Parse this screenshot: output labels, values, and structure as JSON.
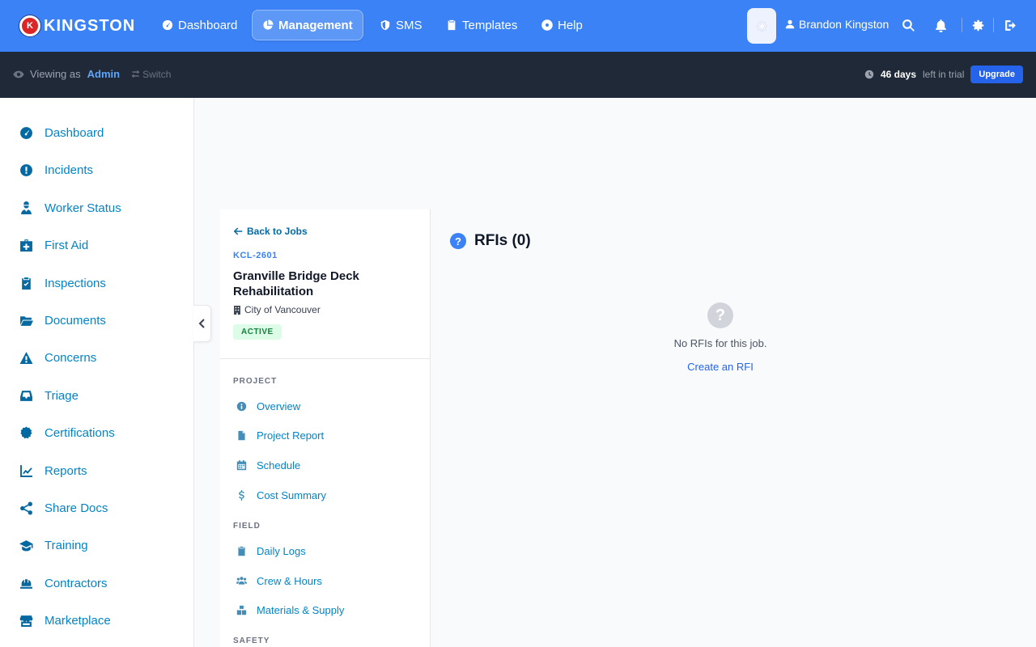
{
  "brand": {
    "name": "KINGSTON",
    "badge": "K"
  },
  "topnav": {
    "items": [
      {
        "label": "Dashboard",
        "icon": "gauge-icon"
      },
      {
        "label": "Management",
        "icon": "pie-chart-icon",
        "active": true
      },
      {
        "label": "SMS",
        "icon": "shield-icon"
      },
      {
        "label": "Templates",
        "icon": "clipboard-icon"
      },
      {
        "label": "Help",
        "icon": "lifebuoy-icon"
      }
    ],
    "user_name": "Brandon Kingston"
  },
  "subbar": {
    "viewing_prefix": "Viewing as",
    "role": "Admin",
    "switch_label": "Switch",
    "trial_days": "46 days",
    "trial_suffix": "left in trial",
    "upgrade_label": "Upgrade"
  },
  "sidebar": {
    "items": [
      {
        "label": "Dashboard",
        "icon": "gauge-icon"
      },
      {
        "label": "Incidents",
        "icon": "alert-circle-icon"
      },
      {
        "label": "Worker Status",
        "icon": "worker-icon"
      },
      {
        "label": "First Aid",
        "icon": "medkit-icon"
      },
      {
        "label": "Inspections",
        "icon": "clipboard-check-icon"
      },
      {
        "label": "Documents",
        "icon": "folder-open-icon"
      },
      {
        "label": "Concerns",
        "icon": "warning-triangle-icon"
      },
      {
        "label": "Triage",
        "icon": "inbox-icon"
      },
      {
        "label": "Certifications",
        "icon": "certificate-icon"
      },
      {
        "label": "Reports",
        "icon": "line-chart-icon"
      },
      {
        "label": "Share Docs",
        "icon": "share-icon"
      },
      {
        "label": "Training",
        "icon": "graduation-cap-icon"
      },
      {
        "label": "Contractors",
        "icon": "hard-hat-icon"
      },
      {
        "label": "Marketplace",
        "icon": "store-icon"
      }
    ]
  },
  "job": {
    "back_label": "Back to Jobs",
    "code": "KCL-2601",
    "title": "Granville Bridge Deck Rehabilitation",
    "client": "City of Vancouver",
    "status": "ACTIVE",
    "sections": [
      {
        "heading": "PROJECT",
        "items": [
          "Overview",
          "Project Report",
          "Schedule",
          "Cost Summary"
        ]
      },
      {
        "heading": "FIELD",
        "items": [
          "Daily Logs",
          "Crew & Hours",
          "Materials & Supply"
        ]
      },
      {
        "heading": "SAFETY",
        "items": []
      }
    ]
  },
  "main": {
    "title": "RFIs (0)",
    "title_icon": "?",
    "empty_icon": "?",
    "empty_text": "No RFIs for this job.",
    "create_label": "Create an RFI"
  }
}
